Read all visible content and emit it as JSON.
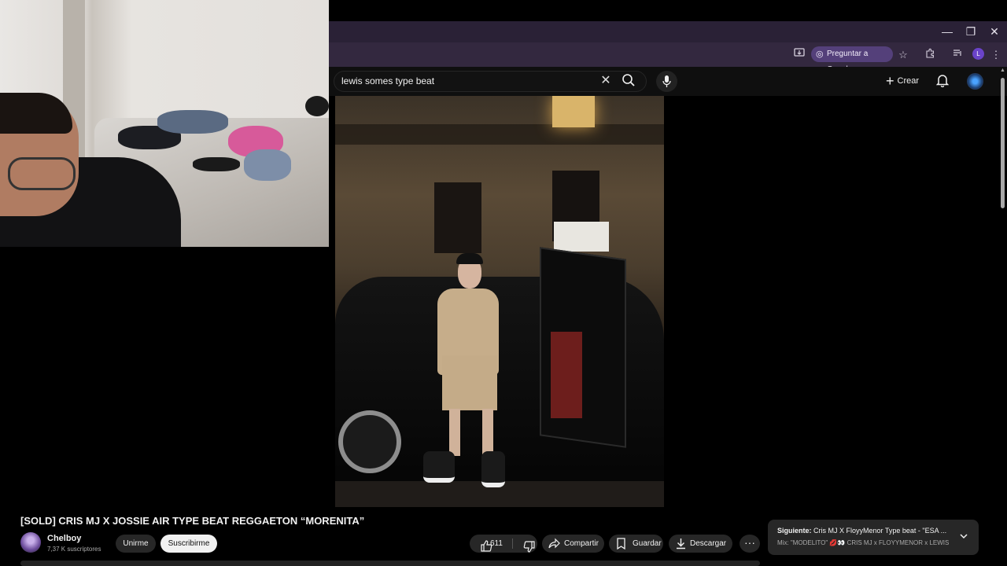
{
  "browser": {
    "ask_google_label": "Preguntar a Google",
    "profile_initial": "L",
    "window_controls": {
      "minimize": "—",
      "restore": "❐",
      "close": "✕"
    }
  },
  "youtube": {
    "search": {
      "query": "lewis somes type beat"
    },
    "create_label": "Crear",
    "video": {
      "title": "[SOLD] CRIS MJ X JOSSIE AIR TYPE BEAT REGGAETON “MORENITA”",
      "channel_name": "Chelboy",
      "subscribers": "7,37 K suscriptores",
      "join_label": "Unirme",
      "subscribe_label": "Suscribirme",
      "likes": "611",
      "share_label": "Compartir",
      "save_label": "Guardar",
      "download_label": "Descargar",
      "more_label": "···"
    },
    "up_next": {
      "prefix": "Siguiente:",
      "title": " Cris MJ X FloyyMenor Type beat - \"ESA ...",
      "subtitle": "Mix: \"MODELITO\" 💋👀 CRIS MJ x FLOYYMENOR x LEWIS S..."
    }
  },
  "colors": {
    "tabstrip": "#2a2136",
    "toolbar": "#33283f",
    "yt_background": "#0f0f0f",
    "pill": "#272727",
    "subscribe_bg": "#f1f1f1"
  }
}
